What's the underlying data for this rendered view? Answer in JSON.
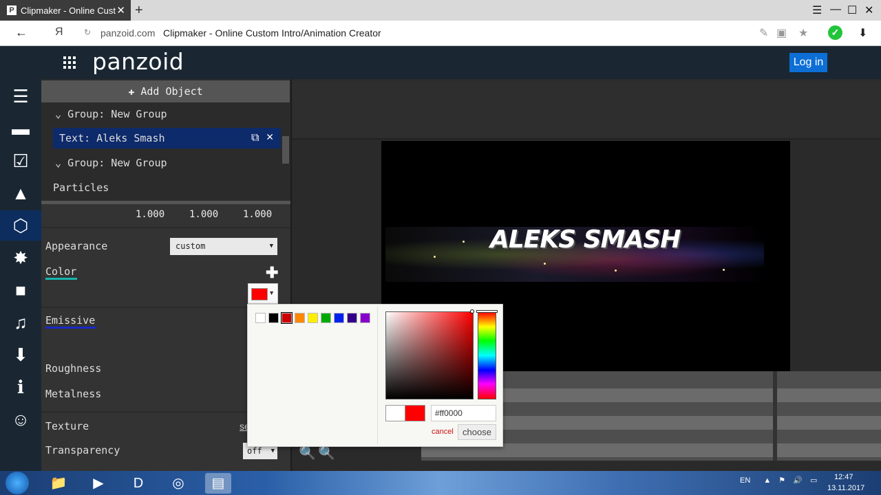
{
  "browser": {
    "tab_title": "Clipmaker - Online Custo",
    "favicon_letter": "P",
    "domain": "panzoid.com",
    "page_title": "Clipmaker - Online Custom Intro/Animation Creator",
    "search_engine_glyph": "Я"
  },
  "header": {
    "logo": "panzoid",
    "login_label": "Log in"
  },
  "sidebar_icons": [
    "menu-icon",
    "folder-icon",
    "checkbox-icon",
    "image-icon",
    "3d-cube-icon",
    "burst-icon",
    "camera-icon",
    "music-icon",
    "download-icon",
    "info-icon",
    "smiley-icon"
  ],
  "objects": {
    "add_label": "Add Object",
    "items": [
      {
        "label": "Group: New Group",
        "type": "group"
      },
      {
        "label": "Text: Aleks Smash",
        "type": "selected"
      },
      {
        "label": "Group: New Group",
        "type": "group"
      },
      {
        "label": "Particles",
        "type": "leaf"
      }
    ]
  },
  "properties": {
    "scale_values": [
      "1.000",
      "1.000",
      "1.000"
    ],
    "appearance_label": "Appearance",
    "appearance_value": "custom",
    "color_label": "Color",
    "emissive_label": "Emissive",
    "roughness_label": "Roughness",
    "metalness_label": "Metalness",
    "texture_label": "Texture",
    "texture_link": "se",
    "transparency_label": "Transparency",
    "transparency_value": "off"
  },
  "color_picker": {
    "current_color": "#ff0000",
    "palette": [
      "#ffffff",
      "#000000",
      "#cc0000",
      "#ff8800",
      "#ffee00",
      "#00aa00",
      "#0022ee",
      "#330088",
      "#8800cc"
    ],
    "hex_value": "#ff0000",
    "cancel_label": "cancel",
    "choose_label": "choose"
  },
  "preview": {
    "text": "ALEKS SMASH"
  },
  "taskbar": {
    "language": "EN",
    "time": "12:47",
    "date": "13.11.2017"
  }
}
